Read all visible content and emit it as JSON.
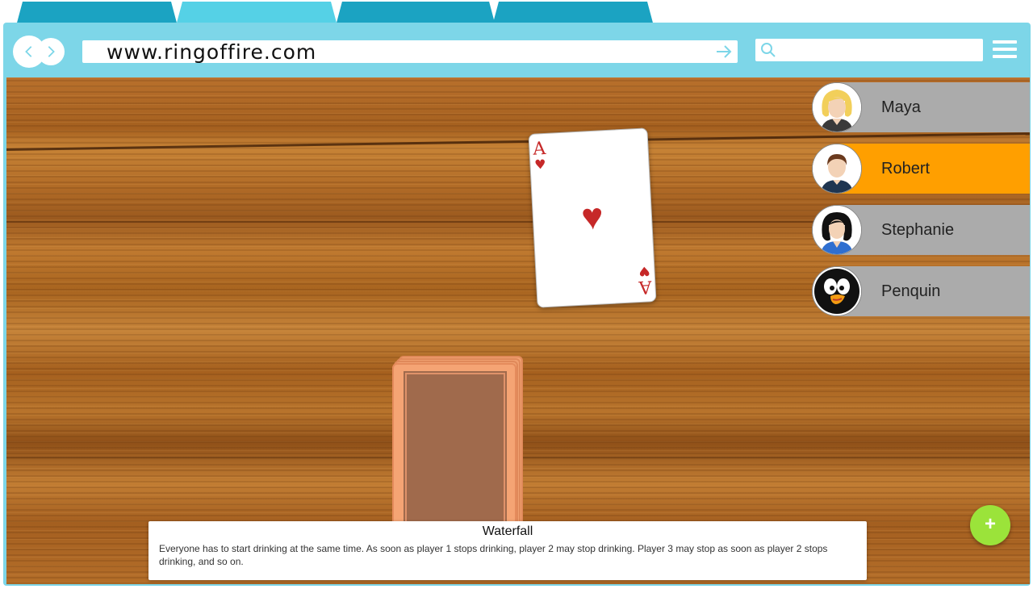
{
  "browser": {
    "url": "www.ringoffire.com",
    "tabs": [
      "",
      "",
      "",
      ""
    ]
  },
  "game": {
    "played_card": {
      "rank": "A",
      "suit": "♥",
      "suit_name": "hearts"
    },
    "players": [
      {
        "name": "Maya",
        "active": false,
        "avatar": "blonde-woman-avatar"
      },
      {
        "name": "Robert",
        "active": true,
        "avatar": "man-avatar"
      },
      {
        "name": "Stephanie",
        "active": false,
        "avatar": "dark-hair-woman-avatar"
      },
      {
        "name": "Penquin",
        "active": false,
        "avatar": "penguin-avatar"
      }
    ],
    "add_player_label": "+",
    "rule": {
      "title": "Waterfall",
      "description": "Everyone has to start drinking at the same time. As soon as player 1 stops drinking, player 2 may stop drinking. Player 3 may stop as soon as player 2 stops drinking, and so on."
    }
  },
  "colors": {
    "frame": "#7dd6e8",
    "active_player": "#ff9f00",
    "inactive_player": "#ababab",
    "add_button": "#9be33a",
    "card_red": "#c62828"
  }
}
